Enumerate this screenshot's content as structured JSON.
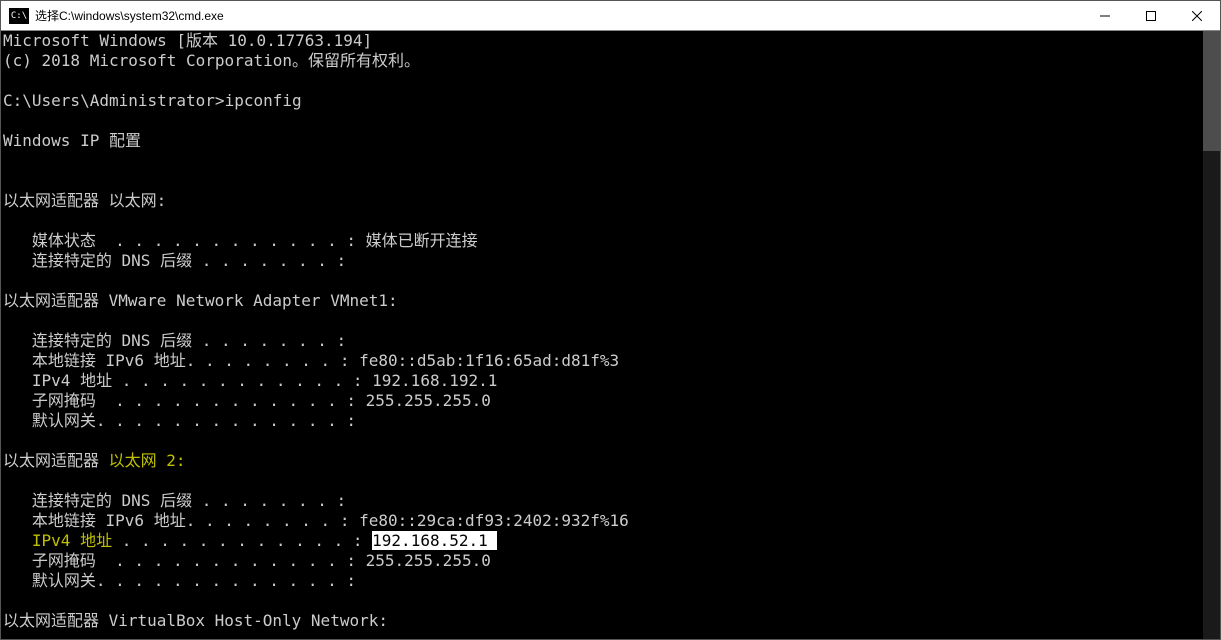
{
  "titlebar": {
    "icon_text": "C:\\",
    "title": "选择C:\\windows\\system32\\cmd.exe"
  },
  "console": {
    "line1": "Microsoft Windows [版本 10.0.17763.194]",
    "line2": "(c) 2018 Microsoft Corporation。保留所有权利。",
    "blank": "",
    "prompt_line_prefix": "C:\\Users\\Administrator>",
    "prompt_command": "ipconfig",
    "ip_header": "Windows IP 配置",
    "adapter1_header": "以太网适配器 以太网:",
    "a1_media": "   媒体状态  . . . . . . . . . . . . : 媒体已断开连接",
    "a1_dns": "   连接特定的 DNS 后缀 . . . . . . . :",
    "adapter2_header": "以太网适配器 VMware Network Adapter VMnet1:",
    "a2_dns": "   连接特定的 DNS 后缀 . . . . . . . :",
    "a2_ipv6": "   本地链接 IPv6 地址. . . . . . . . : fe80::d5ab:1f16:65ad:d81f%3",
    "a2_ipv4": "   IPv4 地址 . . . . . . . . . . . . : 192.168.192.1",
    "a2_mask": "   子网掩码  . . . . . . . . . . . . : 255.255.255.0",
    "a2_gw": "   默认网关. . . . . . . . . . . . . :",
    "adapter3_prefix": "以太网适配器 ",
    "adapter3_name": "以太网 2:",
    "a3_dns": "   连接特定的 DNS 后缀 . . . . . . . :",
    "a3_ipv6": "   本地链接 IPv6 地址. . . . . . . . : fe80::29ca:df93:2402:932f%16",
    "a3_ipv4_label": "   IPv4 地址 ",
    "a3_ipv4_dots": ". . . . . . . . . . . . : ",
    "a3_ipv4_value": "192.168.52.1 ",
    "a3_mask": "   子网掩码  . . . . . . . . . . . . : 255.255.255.0",
    "a3_gw": "   默认网关. . . . . . . . . . . . . :",
    "adapter4_header": "以太网适配器 VirtualBox Host-Only Network:"
  }
}
